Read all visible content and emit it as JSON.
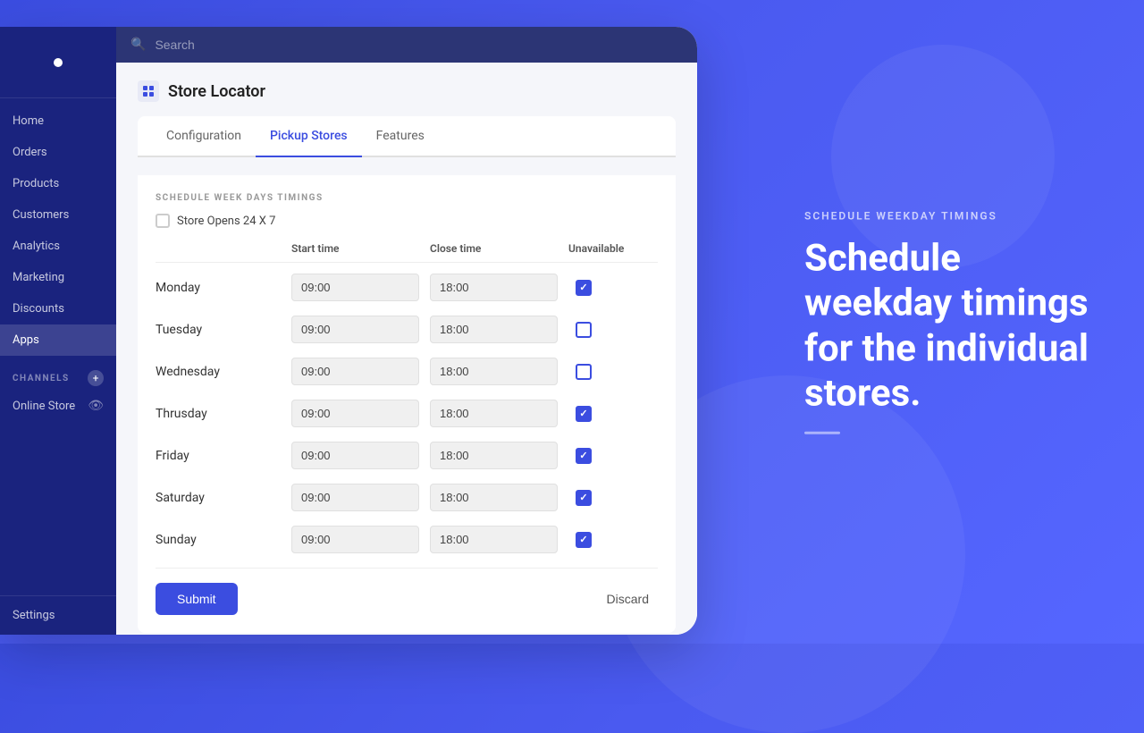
{
  "background": {
    "color": "#3b4de0"
  },
  "right_panel": {
    "subtitle": "SCHEDULE WEEKDAY TIMINGS",
    "title": "Schedule weekday timings for the individual stores."
  },
  "sidebar": {
    "nav_items": [
      {
        "id": "home",
        "label": "Home",
        "active": false
      },
      {
        "id": "orders",
        "label": "Orders",
        "active": false
      },
      {
        "id": "products",
        "label": "Products",
        "active": false
      },
      {
        "id": "customers",
        "label": "Customers",
        "active": false
      },
      {
        "id": "analytics",
        "label": "Analytics",
        "active": false
      },
      {
        "id": "marketing",
        "label": "Marketing",
        "active": false
      },
      {
        "id": "discounts",
        "label": "Discounts",
        "active": false
      },
      {
        "id": "apps",
        "label": "Apps",
        "active": true
      }
    ],
    "channels_label": "CHANNELS",
    "add_channel_label": "+",
    "online_store_label": "Online Store",
    "settings_label": "Settings"
  },
  "search": {
    "placeholder": "Search"
  },
  "page": {
    "title": "Store Locator",
    "tabs": [
      {
        "id": "configuration",
        "label": "Configuration",
        "active": false
      },
      {
        "id": "pickup-stores",
        "label": "Pickup Stores",
        "active": true
      },
      {
        "id": "features",
        "label": "Features",
        "active": false
      }
    ]
  },
  "schedule": {
    "section_title": "SCHEDULE WEEK DAYS TIMINGS",
    "store_opens_label": "Store Opens 24 X 7",
    "store_opens_checked": false,
    "columns": {
      "day": "",
      "start_time": "Start time",
      "close_time": "Close time",
      "unavailable": "Unavailable"
    },
    "days": [
      {
        "id": "monday",
        "label": "Monday",
        "start": "09:00",
        "close": "18:00",
        "unavailable": true
      },
      {
        "id": "tuesday",
        "label": "Tuesday",
        "start": "09:00",
        "close": "18:00",
        "unavailable": false
      },
      {
        "id": "wednesday",
        "label": "Wednesday",
        "start": "09:00",
        "close": "18:00",
        "unavailable": false
      },
      {
        "id": "thursday",
        "label": "Thrusday",
        "start": "09:00",
        "close": "18:00",
        "unavailable": true
      },
      {
        "id": "friday",
        "label": "Friday",
        "start": "09:00",
        "close": "18:00",
        "unavailable": true
      },
      {
        "id": "saturday",
        "label": "Saturday",
        "start": "09:00",
        "close": "18:00",
        "unavailable": true
      },
      {
        "id": "sunday",
        "label": "Sunday",
        "start": "09:00",
        "close": "18:00",
        "unavailable": true
      }
    ]
  },
  "actions": {
    "submit_label": "Submit",
    "discard_label": "Discard"
  }
}
